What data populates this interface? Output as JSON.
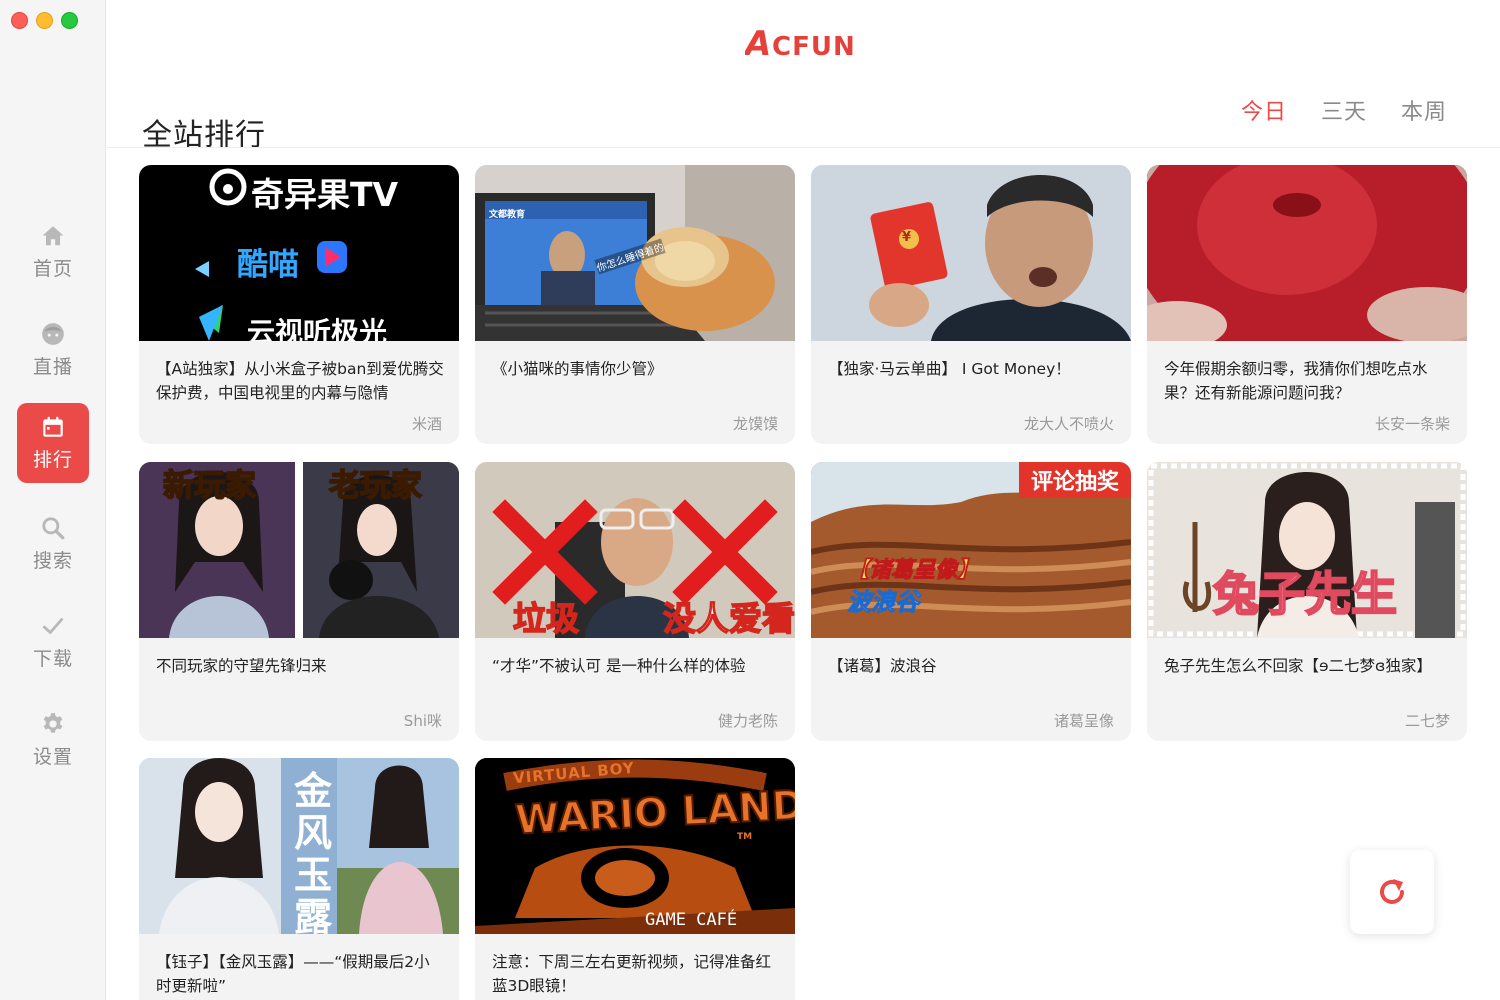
{
  "app": {
    "logo_text": "ACFUN",
    "brand_color": "#ea4a48"
  },
  "sidebar": {
    "items": [
      {
        "label": "首页",
        "icon": "home-icon",
        "active": false
      },
      {
        "label": "直播",
        "icon": "live-face-icon",
        "active": false
      },
      {
        "label": "排行",
        "icon": "calendar-icon",
        "active": true
      },
      {
        "label": "搜索",
        "icon": "search-icon",
        "active": false
      },
      {
        "label": "下载",
        "icon": "check-icon",
        "active": false
      },
      {
        "label": "设置",
        "icon": "gear-icon",
        "active": false
      }
    ]
  },
  "header": {
    "title": "全站排行",
    "tabs": [
      {
        "label": "今日",
        "active": true
      },
      {
        "label": "三天",
        "active": false
      },
      {
        "label": "本周",
        "active": false
      }
    ]
  },
  "videos": [
    {
      "title": "【A站独家】从小米盒子被ban到爱优腾交保护费，中国电视里的内幕与隐情",
      "author": "米酒",
      "thumb_text": [
        "奇异果TV",
        "酷喵",
        "云视听极光"
      ]
    },
    {
      "title": "《小猫咪的事情你少管》",
      "author": "龙馍馍",
      "thumb_text": [
        "文都教育",
        "你怎么睡得着的"
      ]
    },
    {
      "title": "【独家·马云单曲】 I Got Money！",
      "author": "龙大人不喷火",
      "thumb_text": [
        "¥"
      ]
    },
    {
      "title": "今年假期余额归零，我猜你们想吃点水果？还有新能源问题问我？",
      "author": "长安一条柴",
      "thumb_text": []
    },
    {
      "title": "不同玩家的守望先锋归来",
      "author": "Shi咪",
      "thumb_text": [
        "新玩家",
        "老玩家"
      ]
    },
    {
      "title": "“才华”不被认可 是一种什么样的体验",
      "author": "健力老陈",
      "thumb_text": [
        "垃圾",
        "没人爱看"
      ]
    },
    {
      "title": "【诸葛】波浪谷",
      "author": "诸葛呈像",
      "thumb_text": [
        "评论抽奖",
        "【诸葛呈像】",
        "波浪谷"
      ]
    },
    {
      "title": "兔子先生怎么不回家【ɘ二七梦ɞ独家】",
      "author": "二七梦",
      "thumb_text": [
        "兔子先生"
      ]
    },
    {
      "title": "【钰子】【金风玉露】——“假期最后2小时更新啦”",
      "author": "",
      "thumb_text": [
        "金",
        "风",
        "玉",
        "露"
      ]
    },
    {
      "title": "注意：下周三左右更新视频，记得准备红蓝3D眼镜！",
      "author": "",
      "thumb_text": [
        "VIRTUAL BOY",
        "WARIO LAND",
        "TM",
        "GAME CAFÉ"
      ]
    }
  ],
  "refresh": {
    "icon": "refresh-icon"
  }
}
